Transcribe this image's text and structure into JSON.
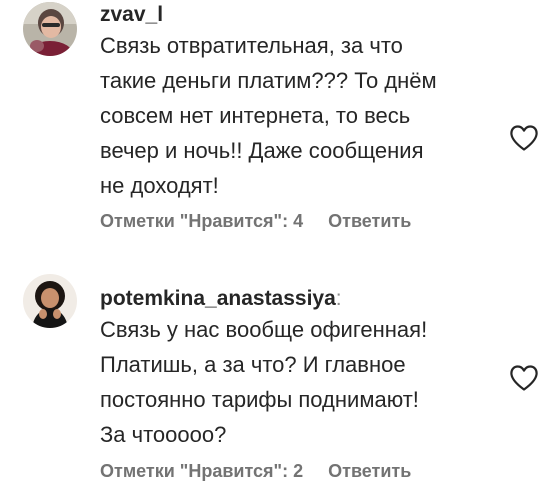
{
  "comments": [
    {
      "username": "zvav_l",
      "username_suffix": "",
      "text_lines": [
        "Связь отвратительная, за что",
        "такие деньги платим??? То днём",
        "совсем нет интернета, то весь",
        "вечер и ночь!! Даже сообщения",
        "не доходят!"
      ],
      "likes_label": "Отметки \"Нравится\": 4",
      "reply_label": "Ответить",
      "like_icon": "heart-outline-icon"
    },
    {
      "username": "potemkina_anastassiya",
      "username_suffix": ":",
      "text_lines": [
        "Связь у нас вообще офигенная!",
        "Платишь, а за что? И главное",
        "постоянно тарифы поднимают!",
        "За чтооооо?"
      ],
      "likes_label": "Отметки \"Нравится\": 2",
      "reply_label": "Ответить",
      "like_icon": "heart-outline-icon"
    }
  ],
  "colors": {
    "text": "#262626",
    "secondary": "#737373",
    "background": "#ffffff"
  }
}
